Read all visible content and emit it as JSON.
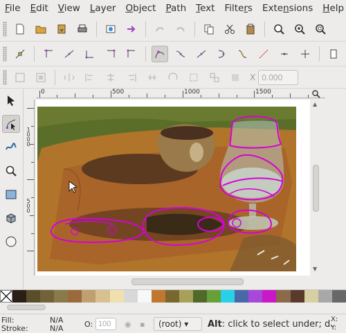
{
  "menu": [
    "File",
    "Edit",
    "View",
    "Layer",
    "Object",
    "Path",
    "Text",
    "Filters",
    "Extensions",
    "Help"
  ],
  "menu_underline": [
    "F",
    "E",
    "V",
    "L",
    "O",
    "P",
    "T",
    "r",
    "n",
    "H"
  ],
  "commands_bar": {
    "icons": [
      "new-document-icon",
      "open-icon",
      "save-icon",
      "print-icon",
      "import-icon",
      "export-icon",
      "undo-icon",
      "redo-icon",
      "copy-icon",
      "cut-icon",
      "paste-icon",
      "zoom-selection-icon",
      "zoom-drawing-icon",
      "zoom-page-icon"
    ]
  },
  "node_bar": {
    "icons": [
      "add-nodes-icon",
      "delete-nodes-icon",
      "join-nodes-icon",
      "break-path-icon",
      "join-segment-icon",
      "delete-segment-icon",
      "cusp-node-icon",
      "smooth-node-icon",
      "symmetric-node-icon",
      "auto-smooth-node-icon",
      "segment-line-icon",
      "segment-curve-icon",
      "object-to-path-icon",
      "stroke-to-path-icon"
    ]
  },
  "align_bar": {
    "x_label": "X",
    "x_value": "0.000"
  },
  "ruler": {
    "h_labels": [
      "0",
      "500",
      "1000",
      "1500"
    ],
    "v_labels": [
      "1000",
      "500"
    ]
  },
  "palette_colors": [
    "#2a1e16",
    "#5a4e2a",
    "#72623a",
    "#8a7a4a",
    "#9a6a3a",
    "#c0a070",
    "#d8c090",
    "#f0e0b0",
    "#d8d8d8",
    "#f8f8f8",
    "#c07830",
    "#786830",
    "#a8a058",
    "#506828",
    "#68a038",
    "#28d0e8",
    "#4868a8",
    "#a848d8",
    "#c818c8",
    "#8a6a4a",
    "#5a3a2a",
    "#d8d0a0",
    "#a8a8a8",
    "#686868"
  ],
  "status": {
    "fill_label": "Fill:",
    "fill_value": "N/A",
    "stroke_label": "Stroke:",
    "stroke_value": "N/A",
    "opacity_label": "O:",
    "opacity_value": "100",
    "layer": "(root)",
    "message_bold": "Alt",
    "message_rest": ": click to select under; d.",
    "x_label": "X:",
    "y_label": "Y:"
  }
}
